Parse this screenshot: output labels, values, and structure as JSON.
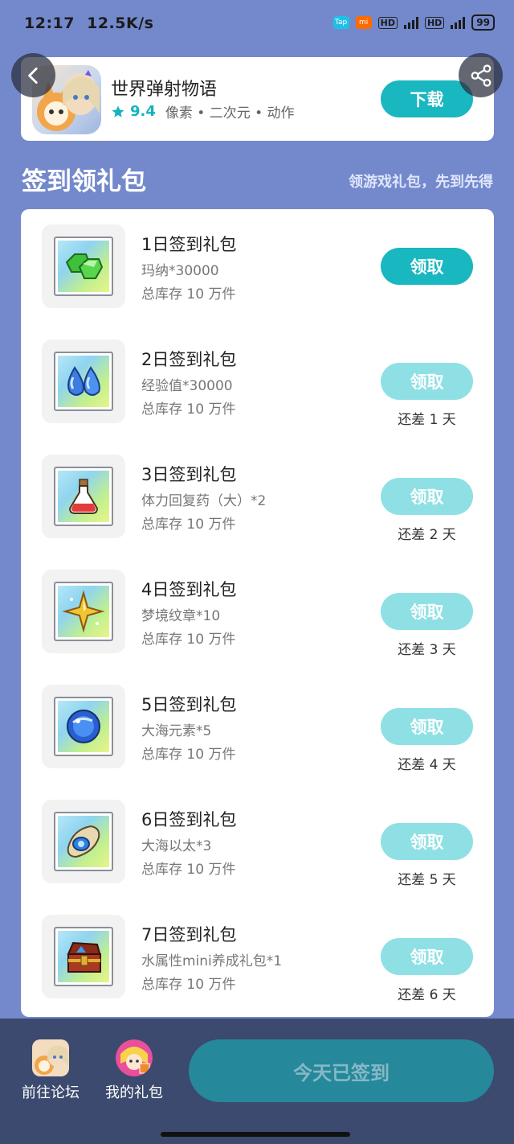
{
  "status_bar": {
    "time": "12:17",
    "speed": "12.5K/s",
    "hd1": "HD",
    "hd2": "HD",
    "battery": "99",
    "app_badge_tap": "Tap",
    "app_badge_mi": "mi"
  },
  "game": {
    "name": "世界弹射物语",
    "rating": "9.4",
    "tags": "像素 • 二次元 • 动作",
    "download_label": "下载"
  },
  "section": {
    "title": "签到领礼包",
    "subtitle": "领游戏礼包，先到先得"
  },
  "gifts": [
    {
      "title": "1日签到礼包",
      "desc": "玛纳*30000",
      "stock": "总库存 10 万件",
      "button": "领取",
      "state": "active",
      "days_left": "",
      "icon": "green-gem-icon"
    },
    {
      "title": "2日签到礼包",
      "desc": "经验值*30000",
      "stock": "总库存 10 万件",
      "button": "领取",
      "state": "disabled",
      "days_left": "还差 1 天",
      "icon": "blue-drops-icon"
    },
    {
      "title": "3日签到礼包",
      "desc": "体力回复药（大）*2",
      "stock": "总库存 10 万件",
      "button": "领取",
      "state": "disabled",
      "days_left": "还差 2 天",
      "icon": "red-potion-icon"
    },
    {
      "title": "4日签到礼包",
      "desc": "梦境纹章*10",
      "stock": "总库存 10 万件",
      "button": "领取",
      "state": "disabled",
      "days_left": "还差 3 天",
      "icon": "gold-star-icon"
    },
    {
      "title": "5日签到礼包",
      "desc": "大海元素*5",
      "stock": "总库存 10 万件",
      "button": "领取",
      "state": "disabled",
      "days_left": "还差 4 天",
      "icon": "blue-orb-icon"
    },
    {
      "title": "6日签到礼包",
      "desc": "大海以太*3",
      "stock": "总库存 10 万件",
      "button": "领取",
      "state": "disabled",
      "days_left": "还差 5 天",
      "icon": "ether-scroll-icon"
    },
    {
      "title": "7日签到礼包",
      "desc": "水属性mini养成礼包*1",
      "stock": "总库存 10 万件",
      "button": "领取",
      "state": "disabled",
      "days_left": "还差 6 天",
      "icon": "treasure-chest-icon"
    }
  ],
  "bottom": {
    "forum_label": "前往论坛",
    "mygifts_label": "我的礼包",
    "signed_label": "今天已签到"
  },
  "colors": {
    "background": "#7489cc",
    "accent": "#19b7bf",
    "accent_disabled": "#8fe0e5",
    "bottom_bar": "#3b4a6e",
    "signed_button": "#26889b"
  }
}
